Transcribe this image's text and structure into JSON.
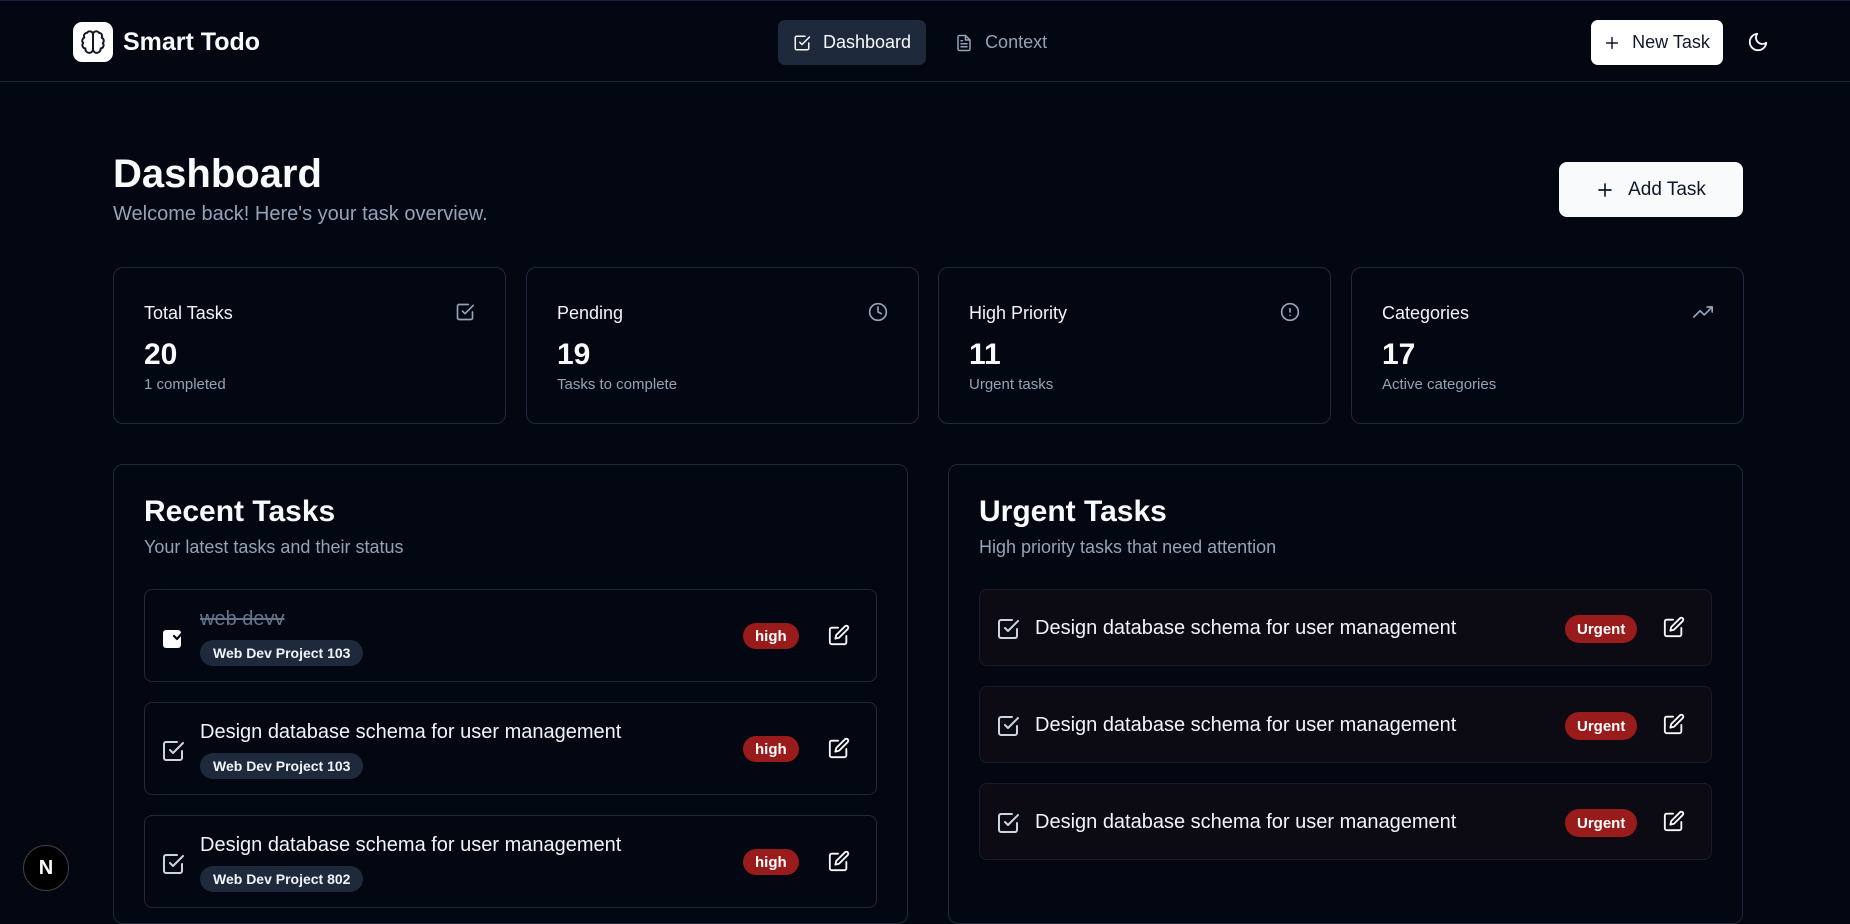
{
  "app": {
    "name": "Smart Todo",
    "logo_icon": "brain-icon"
  },
  "nav": {
    "dashboard_label": "Dashboard",
    "dashboard_icon": "checkbox-icon",
    "context_label": "Context",
    "context_icon": "document-icon",
    "active": "Dashboard"
  },
  "header": {
    "new_task_label": "New Task",
    "theme_icon": "moon-icon"
  },
  "page": {
    "title": "Dashboard",
    "subtitle": "Welcome back! Here's your task overview.",
    "add_task_label": "Add Task"
  },
  "stats": [
    {
      "title": "Total Tasks",
      "value": "20",
      "sub": "1 completed",
      "icon": "checkbox-icon"
    },
    {
      "title": "Pending",
      "value": "19",
      "sub": "Tasks to complete",
      "icon": "clock-icon"
    },
    {
      "title": "High Priority",
      "value": "11",
      "sub": "Urgent tasks",
      "icon": "alert-circle-icon"
    },
    {
      "title": "Categories",
      "value": "17",
      "sub": "Active categories",
      "icon": "trending-up-icon"
    }
  ],
  "recent": {
    "title": "Recent Tasks",
    "subtitle": "Your latest tasks and their status",
    "items": [
      {
        "title": "web devv",
        "tag": "Web Dev Project 103",
        "priority": "high",
        "completed": true
      },
      {
        "title": "Design database schema for user management",
        "tag": "Web Dev Project 103",
        "priority": "high",
        "completed": false
      },
      {
        "title": "Design database schema for user management",
        "tag": "Web Dev Project 802",
        "priority": "high",
        "completed": false
      }
    ]
  },
  "urgent": {
    "title": "Urgent Tasks",
    "subtitle": "High priority tasks that need attention",
    "items": [
      {
        "title": "Design database schema for user management",
        "badge": "Urgent"
      },
      {
        "title": "Design database schema for user management",
        "badge": "Urgent"
      },
      {
        "title": "Design database schema for user management",
        "badge": "Urgent"
      }
    ]
  },
  "dev_badge": {
    "label": "N"
  },
  "colors": {
    "background": "#030712",
    "border": "#1e293b",
    "muted_text": "#94a3b8",
    "badge_red": "#991b1b"
  }
}
